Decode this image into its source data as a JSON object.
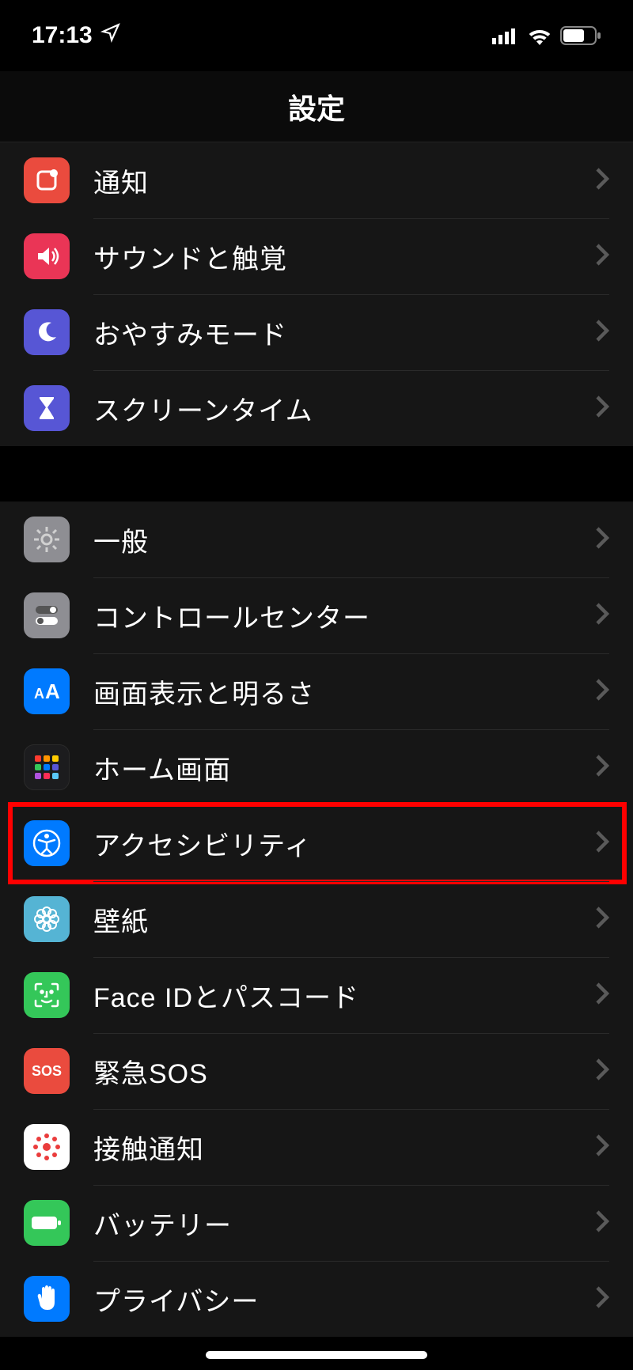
{
  "status": {
    "time": "17:13"
  },
  "header": {
    "title": "設定"
  },
  "section1": [
    {
      "label": "通知"
    },
    {
      "label": "サウンドと触覚"
    },
    {
      "label": "おやすみモード"
    },
    {
      "label": "スクリーンタイム"
    }
  ],
  "section2": [
    {
      "label": "一般"
    },
    {
      "label": "コントロールセンター"
    },
    {
      "label": "画面表示と明るさ"
    },
    {
      "label": "ホーム画面"
    },
    {
      "label": "アクセシビリティ"
    },
    {
      "label": "壁紙"
    },
    {
      "label": "Face IDとパスコード"
    },
    {
      "label": "緊急SOS"
    },
    {
      "label": "接触通知"
    },
    {
      "label": "バッテリー"
    },
    {
      "label": "プライバシー"
    }
  ],
  "highlighted_row": "アクセシビリティ"
}
